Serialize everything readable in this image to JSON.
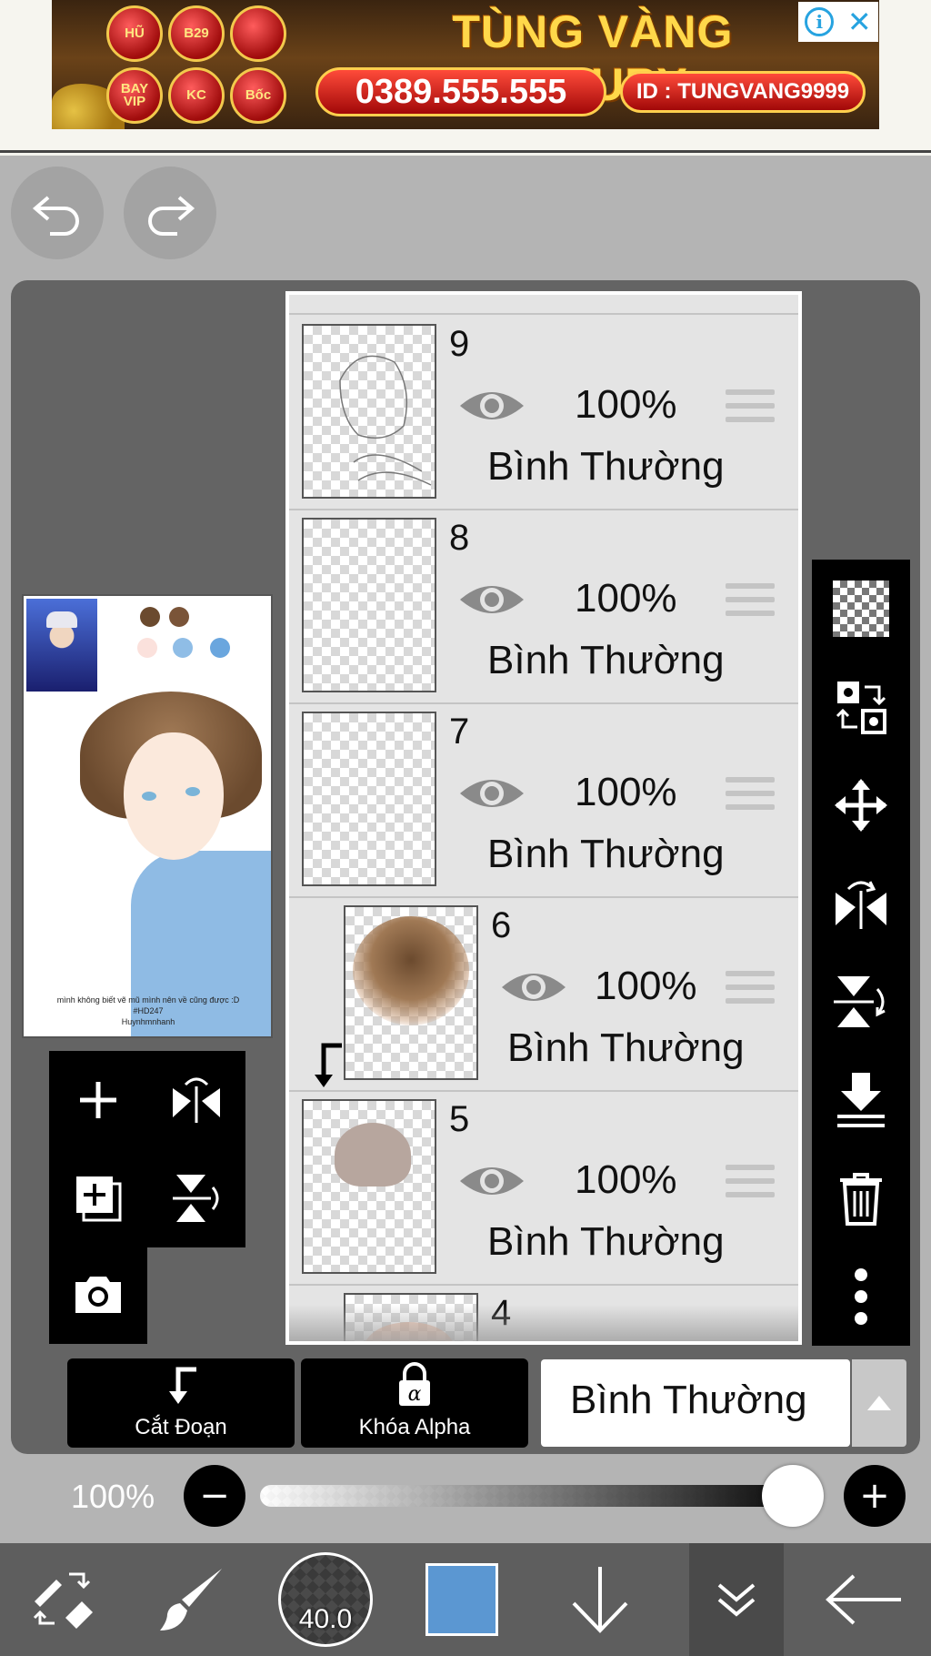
{
  "ad": {
    "title": "TÙNG VÀNG LUXURY",
    "phone": "0389.555.555",
    "id_text": "ID : TUNGVANG9999",
    "logos": [
      "HŨ",
      "B29",
      "",
      "BAY VIP",
      "KC",
      "Bốc"
    ],
    "info_glyph": "i",
    "close_glyph": "✕"
  },
  "preview": {
    "caption_line1": "mình không biết vẽ mũ mình nên về cũng được :D",
    "caption_line2": "#HD247",
    "caption_line3": "Huynhmnhanh",
    "swatches": [
      "#6b4a2e",
      "#7a5438",
      "#fbe1dc",
      "#8fbde6",
      "#6aa6de"
    ]
  },
  "layers": [
    {
      "number": "9",
      "opacity": "100%",
      "blend": "Bình Thường",
      "clipped": false,
      "thumb": "sketch"
    },
    {
      "number": "8",
      "opacity": "100%",
      "blend": "Bình Thường",
      "clipped": false,
      "thumb": "empty"
    },
    {
      "number": "7",
      "opacity": "100%",
      "blend": "Bình Thường",
      "clipped": false,
      "thumb": "empty"
    },
    {
      "number": "6",
      "opacity": "100%",
      "blend": "Bình Thường",
      "clipped": true,
      "thumb": "brown-blur"
    },
    {
      "number": "5",
      "opacity": "100%",
      "blend": "Bình Thường",
      "clipped": false,
      "thumb": "hair"
    },
    {
      "number": "4",
      "opacity": "",
      "blend": "",
      "clipped": true,
      "thumb": "peach"
    }
  ],
  "actions": {
    "clip_label": "Cắt Đoạn",
    "alpha_lock_label": "Khóa Alpha",
    "blend_mode": "Bình Thường"
  },
  "opacity_row": {
    "label": "100%",
    "minus": "−",
    "plus": "+",
    "value": 1.0
  },
  "toolbar": {
    "brush_size": "40.0",
    "current_color": "#5b97d2"
  },
  "colors": {
    "app_bg": "#b4b4b4",
    "panel_bg": "#646464",
    "toolbar_bg": "#5e5e5e"
  }
}
